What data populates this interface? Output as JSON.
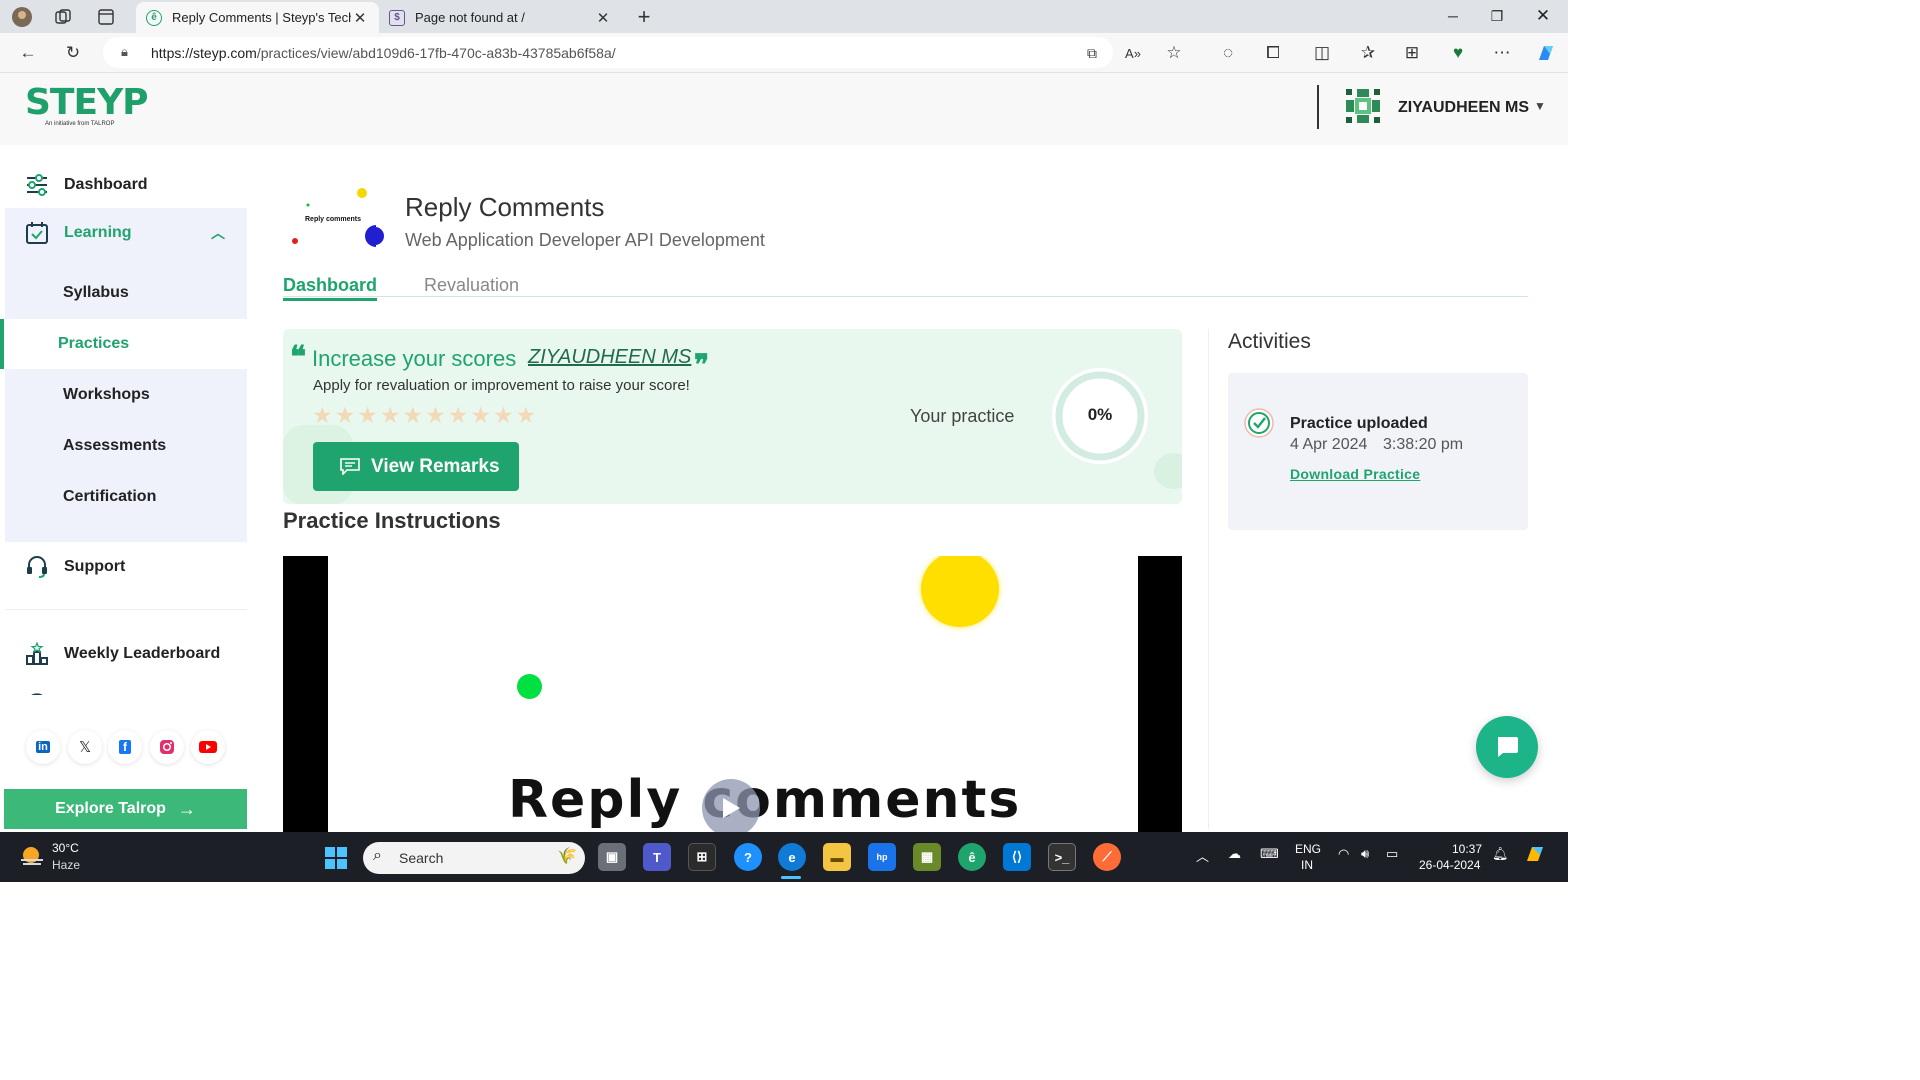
{
  "browser": {
    "tabs": [
      {
        "title": "Reply Comments | Steyp's Tech S",
        "active": true
      },
      {
        "title": "Page not found at /",
        "active": false
      }
    ],
    "url_prefix": "https://steyp.com",
    "url_path": "/practices/view/abd109d6-17fb-470c-a83b-43785ab6f58a/"
  },
  "header": {
    "logo_text": "STEYP",
    "logo_tagline": "An initiative from TALROP",
    "user_name": "ZIYAUDHEEN MS"
  },
  "sidebar": {
    "dashboard": "Dashboard",
    "learning": "Learning",
    "sub_items": [
      "Syllabus",
      "Practices",
      "Workshops",
      "Assessments",
      "Certification"
    ],
    "active_sub": "Practices",
    "support": "Support",
    "leaderboard": "Weekly Leaderboard",
    "explore": "Explore Talrop",
    "socials": [
      "linkedin-icon",
      "x-icon",
      "facebook-icon",
      "instagram-icon",
      "youtube-icon"
    ]
  },
  "main": {
    "thumb_caption": "Reply comments",
    "title": "Reply Comments",
    "subtitle": "Web Application Developer  API Development",
    "tabs": [
      "Dashboard",
      "Revaluation"
    ],
    "score": {
      "headline": "Increase your scores",
      "name": "ZIYAUDHEEN MS",
      "apply_text": "Apply for revaluation or improvement to raise your score!",
      "stars_total": 10,
      "button": "View Remarks",
      "your_practice": "Your practice",
      "progress_label": "0%",
      "progress_value": 0
    },
    "instructions_title": "Practice Instructions",
    "video_title": "Reply comments"
  },
  "activities": {
    "title": "Activities",
    "item_title": "Practice uploaded",
    "date": "4 Apr 2024",
    "time": "3:38:20 pm",
    "link": "Download Practice"
  },
  "taskbar": {
    "temperature": "30°C",
    "weather": "Haze",
    "search": "Search",
    "lang_line1": "ENG",
    "lang_line2": "IN",
    "time": "10:37",
    "date": "26-04-2024"
  },
  "colors": {
    "brand": "#1fa46d",
    "card_bg": "#e9f8ef",
    "sidebar_sub_bg": "#eff1fb",
    "taskbar": "#1c1f26"
  }
}
